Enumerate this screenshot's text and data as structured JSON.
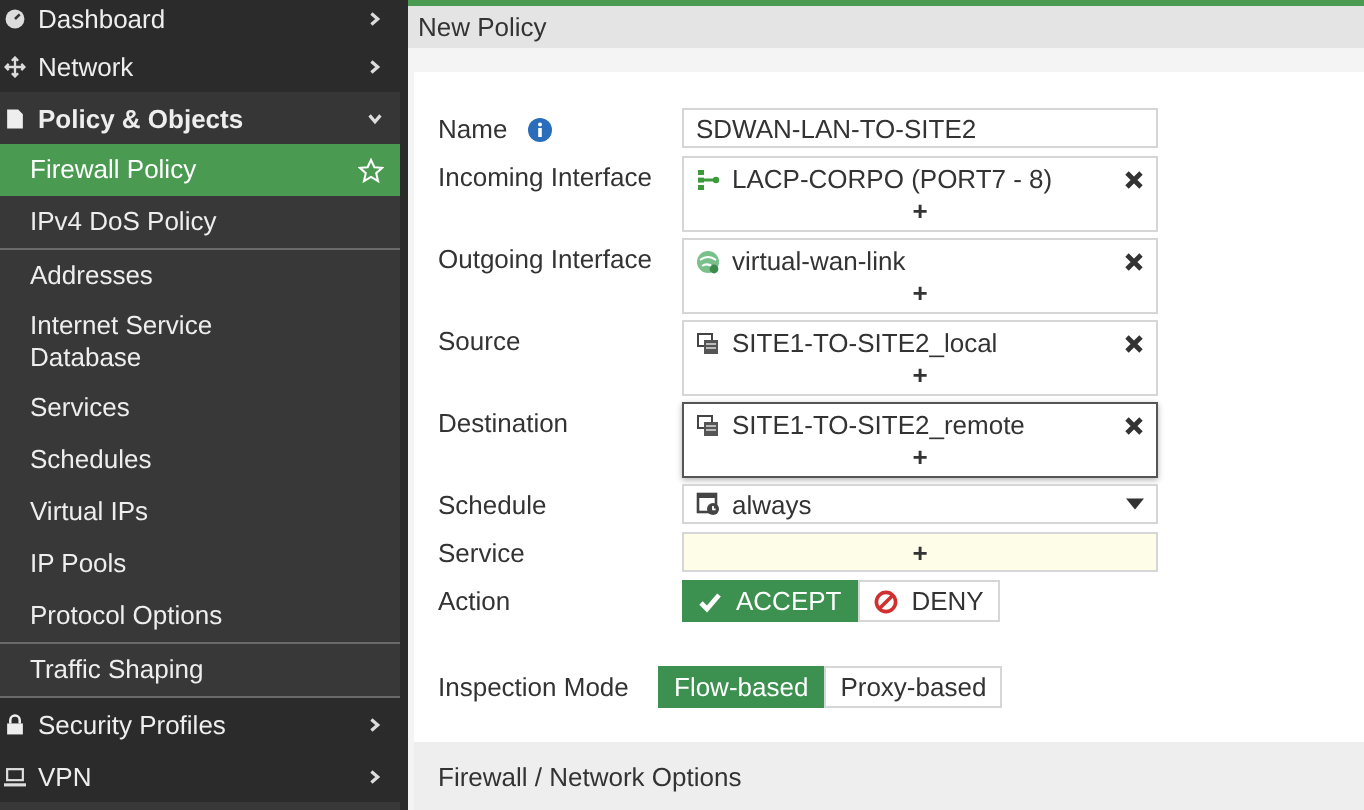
{
  "sidebar": {
    "groups": [
      {
        "label": "Dashboard",
        "expanded": false
      },
      {
        "label": "Network",
        "expanded": false
      },
      {
        "label": "Policy & Objects",
        "expanded": true,
        "sections": [
          [
            {
              "label": "Firewall Policy",
              "selected": true
            },
            {
              "label": "IPv4 DoS Policy",
              "selected": false
            }
          ],
          [
            {
              "label": "Addresses",
              "selected": false
            },
            {
              "label": "Internet Service Database",
              "selected": false
            },
            {
              "label": "Services",
              "selected": false
            },
            {
              "label": "Schedules",
              "selected": false
            },
            {
              "label": "Virtual IPs",
              "selected": false
            },
            {
              "label": "IP Pools",
              "selected": false
            },
            {
              "label": "Protocol Options",
              "selected": false
            }
          ],
          [
            {
              "label": "Traffic Shaping",
              "selected": false
            }
          ]
        ]
      },
      {
        "label": "Security Profiles",
        "expanded": false
      },
      {
        "label": "VPN",
        "expanded": false
      }
    ]
  },
  "page": {
    "title": "New Policy"
  },
  "form": {
    "fields": [
      {
        "kind": "text",
        "label": "Name",
        "info": true,
        "value": "SDWAN-LAN-TO-SITE2"
      },
      {
        "kind": "multi",
        "label": "Incoming Interface",
        "focused": false,
        "entries": [
          {
            "kind": "aggregate",
            "value": "LACP-CORPO (PORT7 - 8)"
          }
        ],
        "add": "+"
      },
      {
        "kind": "multi",
        "label": "Outgoing Interface",
        "focused": false,
        "entries": [
          {
            "kind": "sdwan",
            "value": "virtual-wan-link"
          }
        ],
        "add": "+"
      },
      {
        "kind": "multi",
        "label": "Source",
        "focused": false,
        "entries": [
          {
            "kind": "address",
            "value": "SITE1-TO-SITE2_local"
          }
        ],
        "add": "+"
      },
      {
        "kind": "multi",
        "label": "Destination",
        "focused": true,
        "entries": [
          {
            "kind": "address",
            "value": "SITE1-TO-SITE2_remote"
          }
        ],
        "add": "+"
      },
      {
        "kind": "select",
        "label": "Schedule",
        "value": "always"
      },
      {
        "kind": "add",
        "label": "Service",
        "add": "+"
      },
      {
        "kind": "action",
        "label": "Action",
        "options": [
          {
            "kind": "accept",
            "label": "ACCEPT",
            "selected": true
          },
          {
            "kind": "deny",
            "label": "DENY",
            "selected": false
          }
        ]
      }
    ],
    "inspection": {
      "label": "Inspection Mode",
      "options": [
        {
          "label": "Flow-based",
          "selected": true
        },
        {
          "label": "Proxy-based",
          "selected": false
        }
      ]
    },
    "next_section": "Firewall / Network Options"
  }
}
